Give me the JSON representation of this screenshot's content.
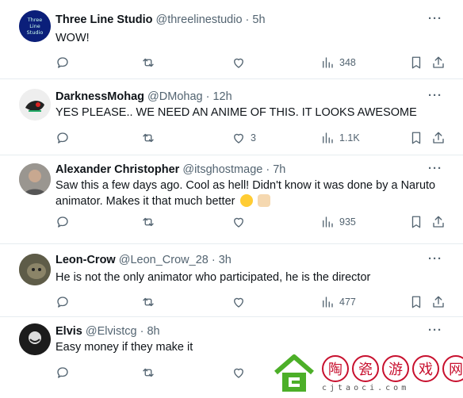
{
  "posts": [
    {
      "name": "Three Line Studio",
      "handle": "@threelinestudio",
      "time": "5h",
      "text": "WOW!",
      "likes": "",
      "views": "348",
      "avatar_text": "Three Line Studio"
    },
    {
      "name": "DarknessMohag",
      "handle": "@DMohag",
      "time": "12h",
      "text": "YES PLEASE.. WE NEED AN ANIME OF THIS. IT LOOKS AWESOME",
      "likes": "3",
      "views": "1.1K"
    },
    {
      "name": "Alexander Christopher",
      "handle": "@itsghostmage",
      "time": "7h",
      "text": "Saw this a few days ago.  Cool as hell! Didn't know it was done by a Naruto animator.  Makes it that much better",
      "likes": "",
      "views": "935"
    },
    {
      "name": "Leon-Crow",
      "handle": "@Leon_Crow_28",
      "time": "3h",
      "text": "He is not the only animator who participated, he is the director",
      "likes": "",
      "views": "477"
    },
    {
      "name": "Elvis",
      "handle": "@Elvistcg",
      "time": "8h",
      "text": "Easy money if they make it",
      "likes": "",
      "views": ""
    }
  ],
  "separator": " · ",
  "more_label": "···",
  "icons": [
    "reply-icon",
    "repost-icon",
    "like-icon",
    "views-icon",
    "bookmark-icon",
    "share-icon"
  ],
  "watermark": {
    "chars": [
      "陶",
      "瓷",
      "游",
      "戏",
      "网"
    ],
    "domain": "cjtaoci.com"
  },
  "colors": {
    "muted": "#536471",
    "text": "#0f1419",
    "divider": "#e6ecf0",
    "watermark_red": "#c8102e",
    "watermark_green": "#4caf28"
  }
}
